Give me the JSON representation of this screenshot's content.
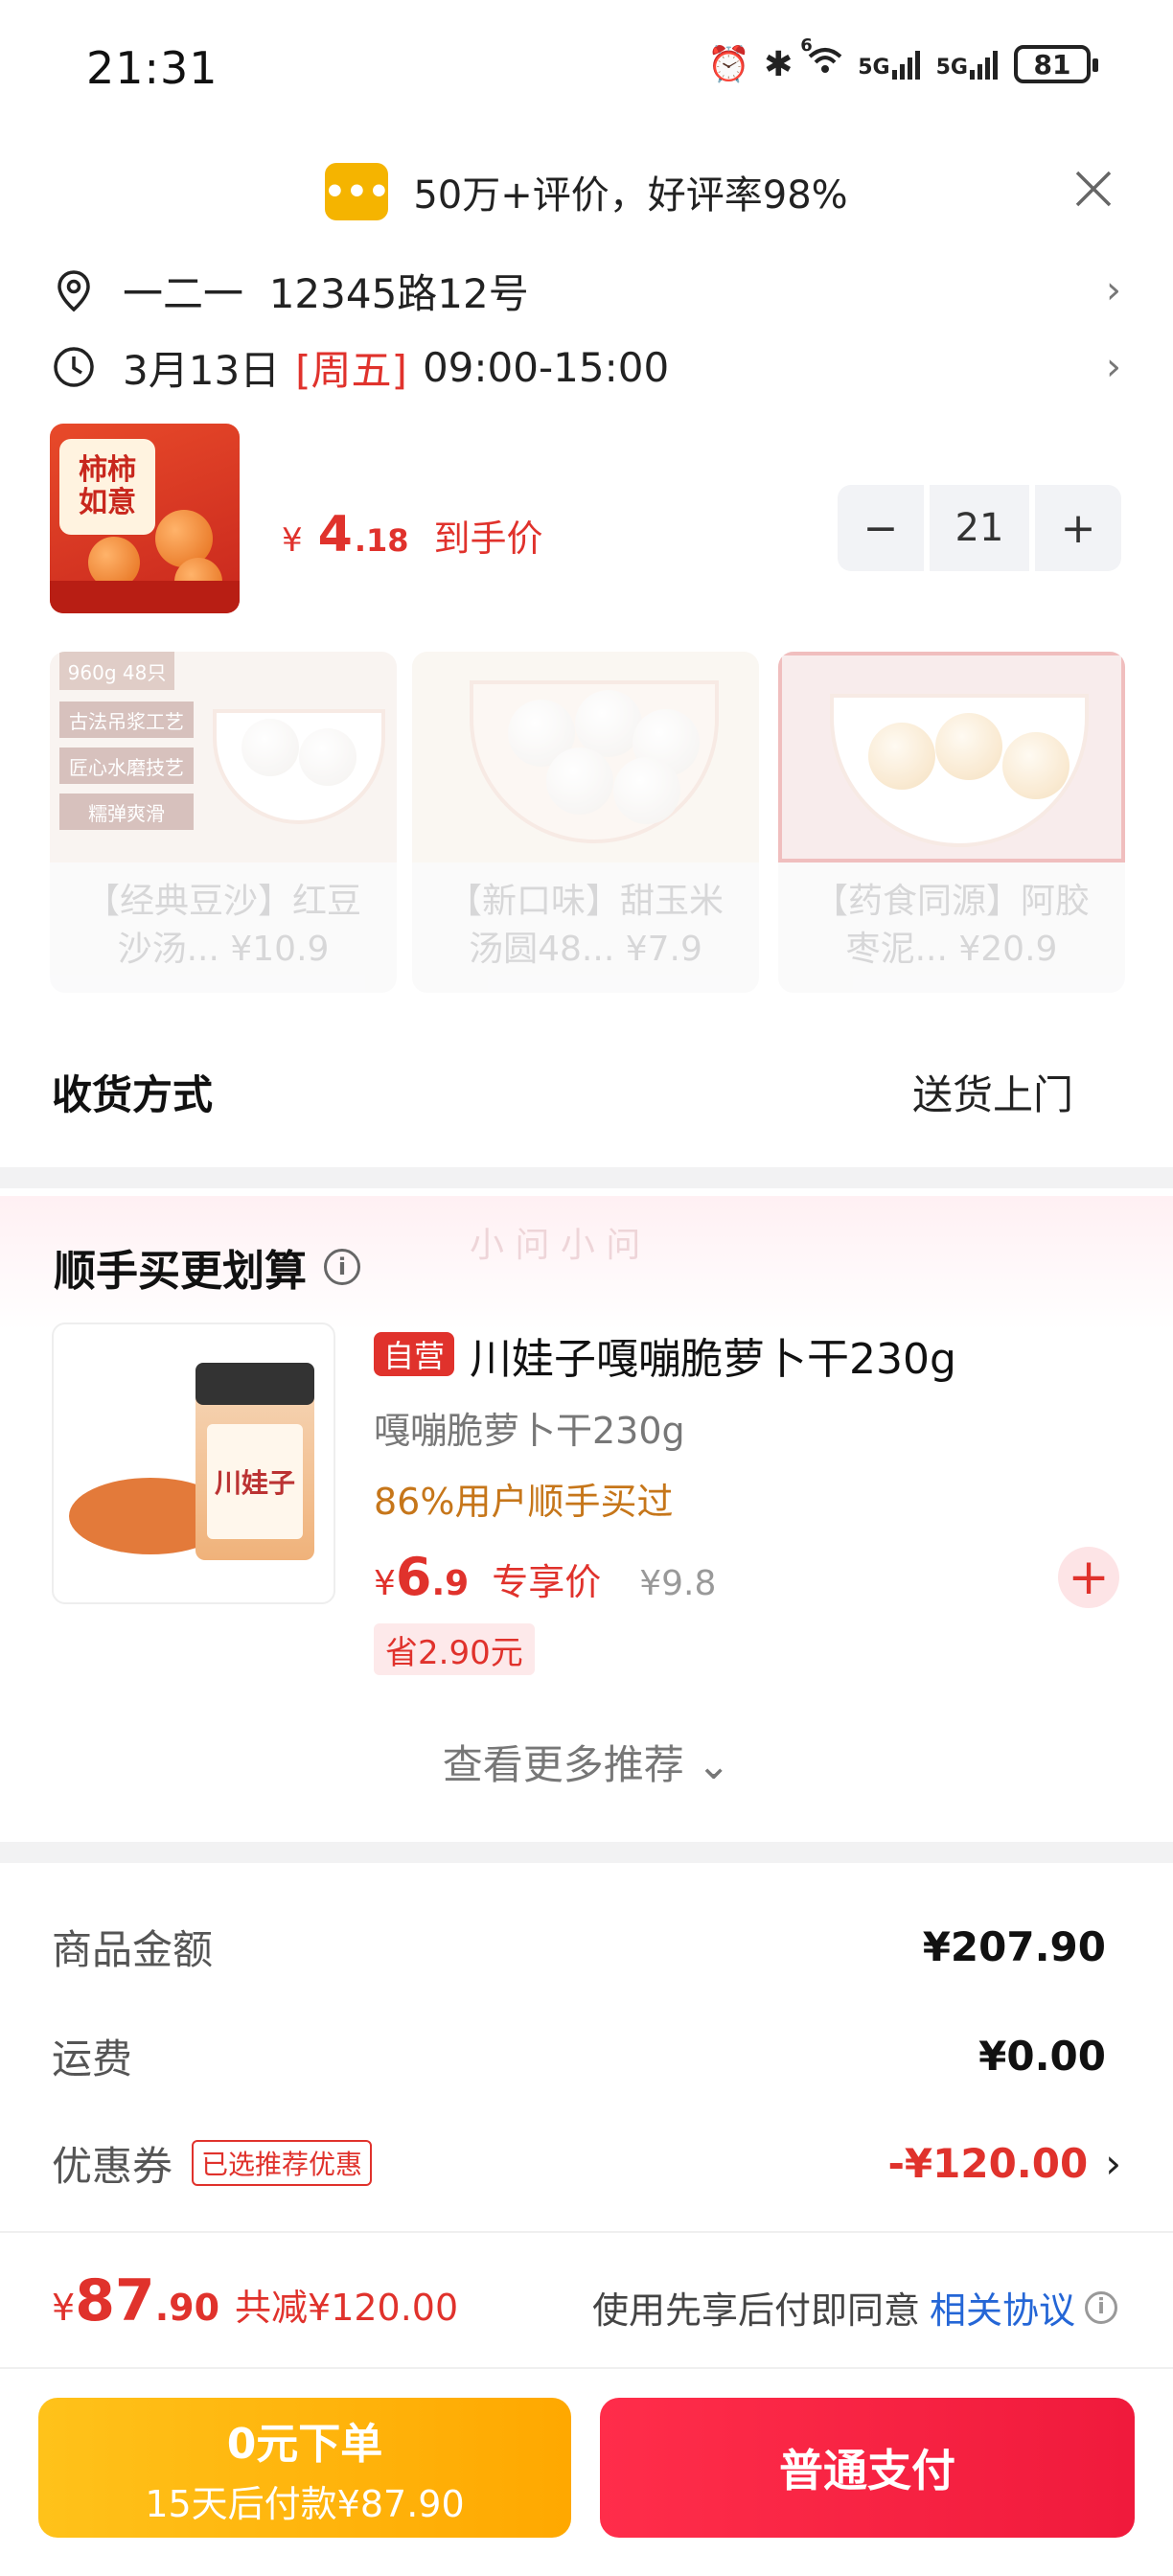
{
  "status_bar": {
    "time": "21:31",
    "battery": "81",
    "signal1": "5G",
    "signal2": "5G",
    "wifi_badge": "6",
    "icons": [
      "alarm-icon",
      "bluetooth-icon",
      "wifi-icon",
      "signal-icon",
      "signal-icon",
      "battery-icon"
    ]
  },
  "review_banner": {
    "icon": "message-icon",
    "text": "50万+评价，好评率98%"
  },
  "address": {
    "text": "一二一  12345路12号"
  },
  "delivery_time": {
    "date": "3月13日",
    "weekday": "[周五]",
    "window": "09:00-15:00"
  },
  "product": {
    "thumb_text": "柿柿\n如意",
    "currency": "¥",
    "price_int": "4",
    "price_dec": ".18",
    "price_label": "到手价",
    "quantity": "21",
    "minus": "−",
    "plus": "+"
  },
  "recommendations": [
    {
      "line1": "【经典豆沙】红豆",
      "line2": "沙汤... ¥10.9"
    },
    {
      "line1": "【新口味】甜玉米",
      "line2": "汤圆48... ¥7.9"
    },
    {
      "line1": "【药食同源】阿胶",
      "line2": "枣泥... ¥20.9"
    }
  ],
  "rec_img_text": [
    "960g 48只",
    "古法吊浆工艺",
    "匠心水磨技艺",
    "糯弹爽滑"
  ],
  "delivery_method": {
    "label": "收货方式",
    "value": "送货上门"
  },
  "buy_together": {
    "title": "顺手买更划算",
    "watermark": "小 问 小 问",
    "item": {
      "tag": "自营",
      "title": "川娃子嘎嘣脆萝卜干230g",
      "subtitle": "嘎嘣脆萝卜干230g",
      "bought": "86%用户顺手买过",
      "currency": "¥",
      "price_int": "6",
      "price_dec": ".9",
      "price_label": "专享价",
      "original": "¥9.8",
      "save": "省2.90元",
      "jar_label": "川娃子"
    },
    "more": "查看更多推荐 ⌄"
  },
  "summary": {
    "goods_label": "商品金额",
    "goods_value": "¥207.90",
    "shipping_label": "运费",
    "shipping_value": "¥0.00",
    "coupon_label": "优惠券",
    "coupon_tag": "已选推荐优惠",
    "coupon_value": "-¥120.00"
  },
  "footer": {
    "currency": "¥",
    "total_int": "87",
    "total_dec": ".90",
    "reduced": "共减¥120.00",
    "agree_prefix": "使用先享后付即同意",
    "agree_link": "相关协议",
    "zero_order_title": "0元下单",
    "zero_order_sub": "15天后付款¥87.90",
    "pay_button": "普通支付"
  },
  "colors": {
    "accent_red": "#e0322c",
    "pay_red": "#f01a3c",
    "zero_yellow": "#ffb000",
    "link_blue": "#2466d6"
  }
}
